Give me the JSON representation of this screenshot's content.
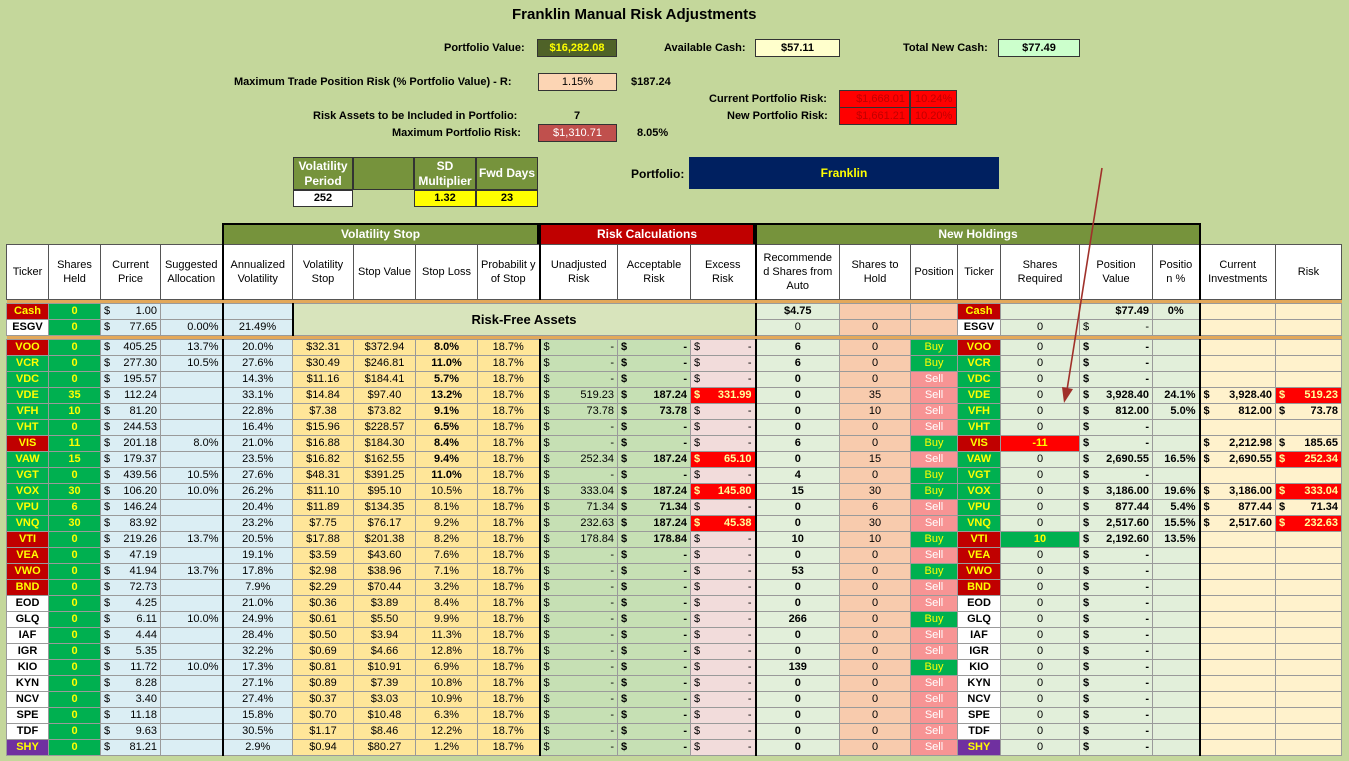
{
  "title": "Franklin Manual Risk Adjustments",
  "summary": {
    "portfolio_value_label": "Portfolio Value:",
    "portfolio_value": "$16,282.08",
    "available_cash_label": "Available Cash:",
    "available_cash": "$57.11",
    "total_new_cash_label": "Total New Cash:",
    "total_new_cash": "$77.49",
    "max_trade_risk_label": "Maximum Trade Position Risk (% Portfolio Value) - R:",
    "max_trade_risk_pct": "1.15%",
    "max_trade_risk_amt": "$187.24",
    "risk_assets_label": "Risk Assets to be Included in Portfolio:",
    "risk_assets_count": "7",
    "max_portfolio_risk_label": "Maximum Portfolio Risk:",
    "max_portfolio_risk_amt": "$1,310.71",
    "max_portfolio_risk_pct": "8.05%",
    "current_risk_label": "Current Portfolio Risk:",
    "current_risk_amt": "$1,668.01",
    "current_risk_pct": "10.24%",
    "new_risk_label": "New Portfolio Risk:",
    "new_risk_amt": "$1,661.21",
    "new_risk_pct": "10.20%",
    "portfolio_label": "Portfolio:",
    "portfolio_name": "Franklin"
  },
  "params": {
    "vol_period_label": "Volatility Period",
    "vol_period": "252",
    "sd_mult_label": "SD Multiplier",
    "sd_mult": "1.32",
    "fwd_days_label": "Fwd Days",
    "fwd_days": "23"
  },
  "groups": {
    "vol_stop": "Volatility Stop",
    "risk_calc": "Risk Calculations",
    "new_holdings": "New Holdings"
  },
  "columns": {
    "ticker": "Ticker",
    "shares_held": "Shares Held",
    "current_price": "Current Price",
    "suggested_alloc": "Suggested Allocation",
    "ann_vol": "Annualized Volatility",
    "vol_stop": "Volatility Stop",
    "stop_value": "Stop Value",
    "stop_loss": "Stop Loss",
    "prob_stop": "Probabilit y of Stop",
    "unadj_risk": "Unadjusted Risk",
    "accept_risk": "Acceptable Risk",
    "excess_risk": "Excess Risk",
    "rec_shares": "Recommende d Shares from Auto",
    "shares_to_hold": "Shares to Hold",
    "position": "Position",
    "ticker2": "Ticker",
    "shares_req": "Shares Required",
    "pos_value": "Position Value",
    "pos_pct": "Positio n %",
    "cur_inv": "Current Investments",
    "risk": "Risk"
  },
  "cash_row": {
    "ticker": "Cash",
    "held": "0",
    "price": "1.00",
    "rec": "$4.75",
    "ticker2": "Cash",
    "pos_value": "$77.49",
    "pos_pct": "0%"
  },
  "esgv_row": {
    "ticker": "ESGV",
    "held": "0",
    "price": "77.65",
    "alloc": "0.00%",
    "vol": "21.49%",
    "riskfree_label": "Risk-Free Assets",
    "rec": "0",
    "hold": "0",
    "ticker2": "ESGV",
    "req": "0",
    "pos_value": "-"
  },
  "currency": "$",
  "rows": [
    {
      "t": "VOO",
      "tc": "#c00000",
      "tf": "#ffff00",
      "h": "0",
      "p": "405.25",
      "a": "13.7%",
      "v": "20.0%",
      "vs": "$32.31",
      "sv": "$372.94",
      "sl": "8.0%",
      "sb": true,
      "pr": "18.7%",
      "u": "-",
      "ac": "-",
      "ex": "-",
      "exr": false,
      "rc": "6",
      "sh": "0",
      "pos": "Buy",
      "req": "0",
      "rq": "",
      "pv": "-",
      "pp": "",
      "ci": "",
      "rk": "",
      "rkr": false
    },
    {
      "t": "VCR",
      "tc": "#00b050",
      "tf": "#ffff00",
      "h": "0",
      "p": "277.30",
      "a": "10.5%",
      "v": "27.6%",
      "vs": "$30.49",
      "sv": "$246.81",
      "sl": "11.0%",
      "sb": true,
      "pr": "18.7%",
      "u": "-",
      "ac": "-",
      "ex": "-",
      "exr": false,
      "rc": "6",
      "sh": "0",
      "pos": "Buy",
      "req": "0",
      "rq": "",
      "pv": "-",
      "pp": "",
      "ci": "",
      "rk": "",
      "rkr": false
    },
    {
      "t": "VDC",
      "tc": "#00b050",
      "tf": "#ffff00",
      "h": "0",
      "p": "195.57",
      "a": "",
      "v": "14.3%",
      "vs": "$11.16",
      "sv": "$184.41",
      "sl": "5.7%",
      "sb": true,
      "pr": "18.7%",
      "u": "-",
      "ac": "-",
      "ex": "-",
      "exr": false,
      "rc": "0",
      "sh": "0",
      "pos": "Sell",
      "req": "0",
      "rq": "",
      "pv": "-",
      "pp": "",
      "ci": "",
      "rk": "",
      "rkr": false
    },
    {
      "t": "VDE",
      "tc": "#00b050",
      "tf": "#ffff00",
      "h": "35",
      "p": "112.24",
      "a": "",
      "v": "33.1%",
      "vs": "$14.84",
      "sv": "$97.40",
      "sl": "13.2%",
      "sb": true,
      "pr": "18.7%",
      "u": "519.23",
      "ac": "187.24",
      "ex": "331.99",
      "exr": true,
      "rc": "0",
      "sh": "35",
      "pos": "Sell",
      "req": "0",
      "rq": "",
      "pv": "3,928.40",
      "pp": "24.1%",
      "ci": "3,928.40",
      "rk": "519.23",
      "rkr": true
    },
    {
      "t": "VFH",
      "tc": "#00b050",
      "tf": "#ffff00",
      "h": "10",
      "p": "81.20",
      "a": "",
      "v": "22.8%",
      "vs": "$7.38",
      "sv": "$73.82",
      "sl": "9.1%",
      "sb": true,
      "pr": "18.7%",
      "u": "73.78",
      "ac": "73.78",
      "ex": "-",
      "exr": false,
      "rc": "0",
      "sh": "10",
      "pos": "Sell",
      "req": "0",
      "rq": "",
      "pv": "812.00",
      "pp": "5.0%",
      "ci": "812.00",
      "rk": "73.78",
      "rkr": false
    },
    {
      "t": "VHT",
      "tc": "#00b050",
      "tf": "#ffff00",
      "h": "0",
      "p": "244.53",
      "a": "",
      "v": "16.4%",
      "vs": "$15.96",
      "sv": "$228.57",
      "sl": "6.5%",
      "sb": true,
      "pr": "18.7%",
      "u": "-",
      "ac": "-",
      "ex": "-",
      "exr": false,
      "rc": "0",
      "sh": "0",
      "pos": "Sell",
      "req": "0",
      "rq": "",
      "pv": "-",
      "pp": "",
      "ci": "",
      "rk": "",
      "rkr": false
    },
    {
      "t": "VIS",
      "tc": "#c00000",
      "tf": "#ffff00",
      "h": "11",
      "p": "201.18",
      "a": "8.0%",
      "v": "21.0%",
      "vs": "$16.88",
      "sv": "$184.30",
      "sl": "8.4%",
      "sb": true,
      "pr": "18.7%",
      "u": "-",
      "ac": "-",
      "ex": "-",
      "exr": false,
      "rc": "6",
      "sh": "0",
      "pos": "Buy",
      "req": "-11",
      "rq": "red",
      "pv": "-",
      "pp": "",
      "ci": "2,212.98",
      "rk": "185.65",
      "rkr": false
    },
    {
      "t": "VAW",
      "tc": "#00b050",
      "tf": "#ffff00",
      "h": "15",
      "p": "179.37",
      "a": "",
      "v": "23.5%",
      "vs": "$16.82",
      "sv": "$162.55",
      "sl": "9.4%",
      "sb": true,
      "pr": "18.7%",
      "u": "252.34",
      "ac": "187.24",
      "ex": "65.10",
      "exr": true,
      "rc": "0",
      "sh": "15",
      "pos": "Sell",
      "req": "0",
      "rq": "",
      "pv": "2,690.55",
      "pp": "16.5%",
      "ci": "2,690.55",
      "rk": "252.34",
      "rkr": true
    },
    {
      "t": "VGT",
      "tc": "#00b050",
      "tf": "#ffff00",
      "h": "0",
      "p": "439.56",
      "a": "10.5%",
      "v": "27.6%",
      "vs": "$48.31",
      "sv": "$391.25",
      "sl": "11.0%",
      "sb": true,
      "pr": "18.7%",
      "u": "-",
      "ac": "-",
      "ex": "-",
      "exr": false,
      "rc": "4",
      "sh": "0",
      "pos": "Buy",
      "req": "0",
      "rq": "",
      "pv": "-",
      "pp": "",
      "ci": "",
      "rk": "",
      "rkr": false
    },
    {
      "t": "VOX",
      "tc": "#00b050",
      "tf": "#ffff00",
      "h": "30",
      "p": "106.20",
      "a": "10.0%",
      "v": "26.2%",
      "vs": "$11.10",
      "sv": "$95.10",
      "sl": "10.5%",
      "sb": false,
      "pr": "18.7%",
      "u": "333.04",
      "ac": "187.24",
      "ex": "145.80",
      "exr": true,
      "rc": "15",
      "sh": "30",
      "pos": "Buy",
      "req": "0",
      "rq": "",
      "pv": "3,186.00",
      "pp": "19.6%",
      "ci": "3,186.00",
      "rk": "333.04",
      "rkr": true
    },
    {
      "t": "VPU",
      "tc": "#00b050",
      "tf": "#ffff00",
      "h": "6",
      "p": "146.24",
      "a": "",
      "v": "20.4%",
      "vs": "$11.89",
      "sv": "$134.35",
      "sl": "8.1%",
      "sb": false,
      "pr": "18.7%",
      "u": "71.34",
      "ac": "71.34",
      "ex": "-",
      "exr": false,
      "rc": "0",
      "sh": "6",
      "pos": "Sell",
      "req": "0",
      "rq": "",
      "pv": "877.44",
      "pp": "5.4%",
      "ci": "877.44",
      "rk": "71.34",
      "rkr": false
    },
    {
      "t": "VNQ",
      "tc": "#00b050",
      "tf": "#ffff00",
      "h": "30",
      "p": "83.92",
      "a": "",
      "v": "23.2%",
      "vs": "$7.75",
      "sv": "$76.17",
      "sl": "9.2%",
      "sb": false,
      "pr": "18.7%",
      "u": "232.63",
      "ac": "187.24",
      "ex": "45.38",
      "exr": true,
      "rc": "0",
      "sh": "30",
      "pos": "Sell",
      "req": "0",
      "rq": "",
      "pv": "2,517.60",
      "pp": "15.5%",
      "ci": "2,517.60",
      "rk": "232.63",
      "rkr": true
    },
    {
      "t": "VTI",
      "tc": "#c00000",
      "tf": "#ffff00",
      "h": "0",
      "p": "219.26",
      "a": "13.7%",
      "v": "20.5%",
      "vs": "$17.88",
      "sv": "$201.38",
      "sl": "8.2%",
      "sb": false,
      "pr": "18.7%",
      "u": "178.84",
      "ac": "178.84",
      "ex": "-",
      "exr": false,
      "rc": "10",
      "sh": "10",
      "pos": "Buy",
      "req": "10",
      "rq": "green",
      "pv": "2,192.60",
      "pp": "13.5%",
      "ci": "",
      "rk": "",
      "rkr": false
    },
    {
      "t": "VEA",
      "tc": "#c00000",
      "tf": "#ffff00",
      "h": "0",
      "p": "47.19",
      "a": "",
      "v": "19.1%",
      "vs": "$3.59",
      "sv": "$43.60",
      "sl": "7.6%",
      "sb": false,
      "pr": "18.7%",
      "u": "-",
      "ac": "-",
      "ex": "-",
      "exr": false,
      "rc": "0",
      "sh": "0",
      "pos": "Sell",
      "req": "0",
      "rq": "",
      "pv": "-",
      "pp": "",
      "ci": "",
      "rk": "",
      "rkr": false
    },
    {
      "t": "VWO",
      "tc": "#c00000",
      "tf": "#ffff00",
      "h": "0",
      "p": "41.94",
      "a": "13.7%",
      "v": "17.8%",
      "vs": "$2.98",
      "sv": "$38.96",
      "sl": "7.1%",
      "sb": false,
      "pr": "18.7%",
      "u": "-",
      "ac": "-",
      "ex": "-",
      "exr": false,
      "rc": "53",
      "sh": "0",
      "pos": "Buy",
      "req": "0",
      "rq": "",
      "pv": "-",
      "pp": "",
      "ci": "",
      "rk": "",
      "rkr": false
    },
    {
      "t": "BND",
      "tc": "#c00000",
      "tf": "#ffff00",
      "h": "0",
      "p": "72.73",
      "a": "",
      "v": "7.9%",
      "vs": "$2.29",
      "sv": "$70.44",
      "sl": "3.2%",
      "sb": false,
      "pr": "18.7%",
      "u": "-",
      "ac": "-",
      "ex": "-",
      "exr": false,
      "rc": "0",
      "sh": "0",
      "pos": "Sell",
      "req": "0",
      "rq": "",
      "pv": "-",
      "pp": "",
      "ci": "",
      "rk": "",
      "rkr": false
    },
    {
      "t": "EOD",
      "tc": "#ffffff",
      "tf": "#000000",
      "h": "0",
      "p": "4.25",
      "a": "",
      "v": "21.0%",
      "vs": "$0.36",
      "sv": "$3.89",
      "sl": "8.4%",
      "sb": false,
      "pr": "18.7%",
      "u": "-",
      "ac": "-",
      "ex": "-",
      "exr": false,
      "rc": "0",
      "sh": "0",
      "pos": "Sell",
      "req": "0",
      "rq": "",
      "pv": "-",
      "pp": "",
      "ci": "",
      "rk": "",
      "rkr": false
    },
    {
      "t": "GLQ",
      "tc": "#ffffff",
      "tf": "#000000",
      "h": "0",
      "p": "6.11",
      "a": "10.0%",
      "v": "24.9%",
      "vs": "$0.61",
      "sv": "$5.50",
      "sl": "9.9%",
      "sb": false,
      "pr": "18.7%",
      "u": "-",
      "ac": "-",
      "ex": "-",
      "exr": false,
      "rc": "266",
      "sh": "0",
      "pos": "Buy",
      "req": "0",
      "rq": "",
      "pv": "-",
      "pp": "",
      "ci": "",
      "rk": "",
      "rkr": false
    },
    {
      "t": "IAF",
      "tc": "#ffffff",
      "tf": "#000000",
      "h": "0",
      "p": "4.44",
      "a": "",
      "v": "28.4%",
      "vs": "$0.50",
      "sv": "$3.94",
      "sl": "11.3%",
      "sb": false,
      "pr": "18.7%",
      "u": "-",
      "ac": "-",
      "ex": "-",
      "exr": false,
      "rc": "0",
      "sh": "0",
      "pos": "Sell",
      "req": "0",
      "rq": "",
      "pv": "-",
      "pp": "",
      "ci": "",
      "rk": "",
      "rkr": false
    },
    {
      "t": "IGR",
      "tc": "#ffffff",
      "tf": "#000000",
      "h": "0",
      "p": "5.35",
      "a": "",
      "v": "32.2%",
      "vs": "$0.69",
      "sv": "$4.66",
      "sl": "12.8%",
      "sb": false,
      "pr": "18.7%",
      "u": "-",
      "ac": "-",
      "ex": "-",
      "exr": false,
      "rc": "0",
      "sh": "0",
      "pos": "Sell",
      "req": "0",
      "rq": "",
      "pv": "-",
      "pp": "",
      "ci": "",
      "rk": "",
      "rkr": false
    },
    {
      "t": "KIO",
      "tc": "#ffffff",
      "tf": "#000000",
      "h": "0",
      "p": "11.72",
      "a": "10.0%",
      "v": "17.3%",
      "vs": "$0.81",
      "sv": "$10.91",
      "sl": "6.9%",
      "sb": false,
      "pr": "18.7%",
      "u": "-",
      "ac": "-",
      "ex": "-",
      "exr": false,
      "rc": "139",
      "sh": "0",
      "pos": "Buy",
      "req": "0",
      "rq": "",
      "pv": "-",
      "pp": "",
      "ci": "",
      "rk": "",
      "rkr": false
    },
    {
      "t": "KYN",
      "tc": "#ffffff",
      "tf": "#000000",
      "h": "0",
      "p": "8.28",
      "a": "",
      "v": "27.1%",
      "vs": "$0.89",
      "sv": "$7.39",
      "sl": "10.8%",
      "sb": false,
      "pr": "18.7%",
      "u": "-",
      "ac": "-",
      "ex": "-",
      "exr": false,
      "rc": "0",
      "sh": "0",
      "pos": "Sell",
      "req": "0",
      "rq": "",
      "pv": "-",
      "pp": "",
      "ci": "",
      "rk": "",
      "rkr": false
    },
    {
      "t": "NCV",
      "tc": "#ffffff",
      "tf": "#000000",
      "h": "0",
      "p": "3.40",
      "a": "",
      "v": "27.4%",
      "vs": "$0.37",
      "sv": "$3.03",
      "sl": "10.9%",
      "sb": false,
      "pr": "18.7%",
      "u": "-",
      "ac": "-",
      "ex": "-",
      "exr": false,
      "rc": "0",
      "sh": "0",
      "pos": "Sell",
      "req": "0",
      "rq": "",
      "pv": "-",
      "pp": "",
      "ci": "",
      "rk": "",
      "rkr": false
    },
    {
      "t": "SPE",
      "tc": "#ffffff",
      "tf": "#000000",
      "h": "0",
      "p": "11.18",
      "a": "",
      "v": "15.8%",
      "vs": "$0.70",
      "sv": "$10.48",
      "sl": "6.3%",
      "sb": false,
      "pr": "18.7%",
      "u": "-",
      "ac": "-",
      "ex": "-",
      "exr": false,
      "rc": "0",
      "sh": "0",
      "pos": "Sell",
      "req": "0",
      "rq": "",
      "pv": "-",
      "pp": "",
      "ci": "",
      "rk": "",
      "rkr": false
    },
    {
      "t": "TDF",
      "tc": "#ffffff",
      "tf": "#000000",
      "h": "0",
      "p": "9.63",
      "a": "",
      "v": "30.5%",
      "vs": "$1.17",
      "sv": "$8.46",
      "sl": "12.2%",
      "sb": false,
      "pr": "18.7%",
      "u": "-",
      "ac": "-",
      "ex": "-",
      "exr": false,
      "rc": "0",
      "sh": "0",
      "pos": "Sell",
      "req": "0",
      "rq": "",
      "pv": "-",
      "pp": "",
      "ci": "",
      "rk": "",
      "rkr": false
    },
    {
      "t": "SHY",
      "tc": "#7030a0",
      "tf": "#ffff00",
      "h": "0",
      "p": "81.21",
      "a": "",
      "v": "2.9%",
      "vs": "$0.94",
      "sv": "$80.27",
      "sl": "1.2%",
      "sb": false,
      "pr": "18.7%",
      "u": "-",
      "ac": "-",
      "ex": "-",
      "exr": false,
      "rc": "0",
      "sh": "0",
      "pos": "Sell",
      "req": "0",
      "rq": "",
      "pv": "-",
      "pp": "",
      "ci": "",
      "rk": "",
      "rkr": false
    }
  ]
}
